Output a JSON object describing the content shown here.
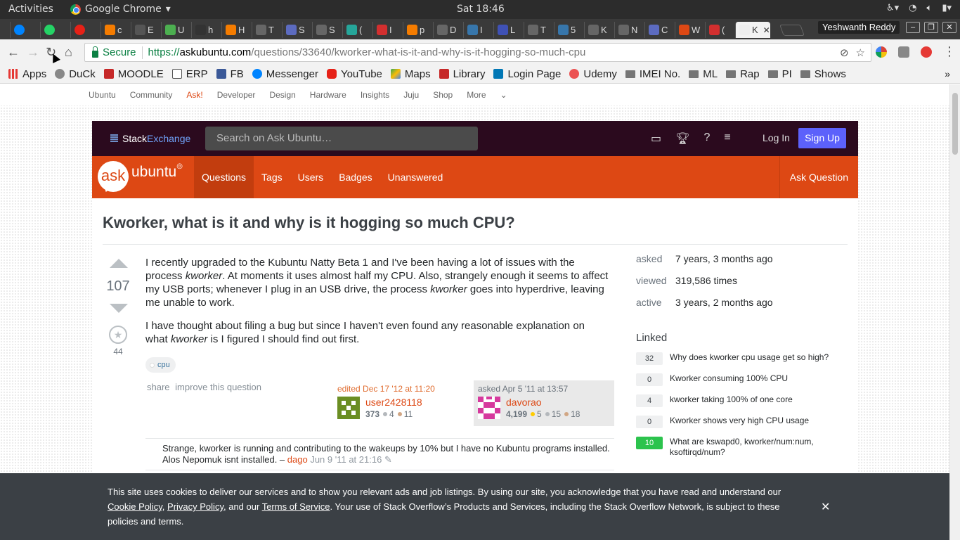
{
  "os": {
    "activities": "Activities",
    "app_name": "Google Chrome",
    "clock": "Sat 18:46"
  },
  "browser": {
    "tabs": [
      {
        "label": ""
      },
      {
        "label": ""
      },
      {
        "label": ""
      },
      {
        "label": "c"
      },
      {
        "label": "E"
      },
      {
        "label": "U"
      },
      {
        "label": "h"
      },
      {
        "label": "H"
      },
      {
        "label": "T"
      },
      {
        "label": "S"
      },
      {
        "label": "S"
      },
      {
        "label": "("
      },
      {
        "label": "I"
      },
      {
        "label": "p"
      },
      {
        "label": "D"
      },
      {
        "label": "I"
      },
      {
        "label": "L"
      },
      {
        "label": "T"
      },
      {
        "label": "5"
      },
      {
        "label": "K"
      },
      {
        "label": "N"
      },
      {
        "label": "C"
      },
      {
        "label": "W"
      },
      {
        "label": "("
      },
      {
        "label": "K"
      }
    ],
    "user": "Yeshwanth Reddy",
    "secure_label": "Secure",
    "url_scheme": "https://",
    "url_domain": "askubuntu.com",
    "url_path": "/questions/33640/kworker-what-is-it-and-why-is-it-hogging-so-much-cpu",
    "bookmarks": [
      "Apps",
      "DuCk",
      "MOODLE",
      "ERP",
      "FB",
      "Messenger",
      "YouTube",
      "Maps",
      "Library",
      "Login Page",
      "Udemy",
      "IMEI No.",
      "ML",
      "Rap",
      "PI",
      "Shows"
    ],
    "bookmark_more": "»"
  },
  "ubuntu_nav": [
    "Ubuntu",
    "Community",
    "Ask!",
    "Developer",
    "Design",
    "Hardware",
    "Insights",
    "Juju",
    "Shop",
    "More"
  ],
  "stackexchange": {
    "brand1": "Stack",
    "brand2": "Exchange",
    "search_placeholder": "Search on Ask Ubuntu…",
    "login": "Log In",
    "signup": "Sign Up"
  },
  "askubuntu": {
    "bubble": "ask",
    "word": "ubuntu",
    "nav": [
      "Questions",
      "Tags",
      "Users",
      "Badges",
      "Unanswered"
    ],
    "ask_button": "Ask Question"
  },
  "question": {
    "title": "Kworker, what is it and why is it hogging so much CPU?",
    "score": "107",
    "favorites": "44",
    "p1_a": "I recently upgraded to the Kubuntu Natty Beta 1 and I've been having a lot of issues with the process ",
    "p1_em1": "kworker",
    "p1_b": ". At moments it uses almost half my CPU. Also, strangely enough it seems to affect my USB ports; whenever I plug in an USB drive, the process ",
    "p1_em2": "kworker",
    "p1_c": " goes into hyperdrive, leaving me unable to work.",
    "p2_a": "I have thought about filing a bug but since I haven't even found any reasonable explanation on what ",
    "p2_em": "kworker",
    "p2_b": " is I figured I should find out first.",
    "tag": "cpu",
    "share": "share",
    "improve": "improve this question",
    "edited": {
      "label": "edited Dec 17 '12 at 11:20",
      "user": "user2428118",
      "rep": "373",
      "silver": "4",
      "bronze": "11"
    },
    "asked": {
      "label": "asked Apr 5 '11 at 13:57",
      "user": "davorao",
      "rep": "4,199",
      "gold": "5",
      "silver": "15",
      "bronze": "18"
    }
  },
  "comment": {
    "text": "Strange, kworker is running and contributing to the wakeups by 10% but I have no Kubuntu programs installed. Alos Nepomuk isnt installed. –",
    "user": "dago",
    "time": "Jun 9 '11 at 21:16"
  },
  "stats": [
    {
      "k": "asked",
      "v": "7 years, 3 months ago"
    },
    {
      "k": "viewed",
      "v": "319,586 times"
    },
    {
      "k": "active",
      "v": "3 years, 2 months ago"
    }
  ],
  "linked": {
    "heading": "Linked",
    "items": [
      {
        "n": "32",
        "t": "Why does kworker cpu usage get so high?"
      },
      {
        "n": "0",
        "t": "Kworker consuming 100% CPU"
      },
      {
        "n": "4",
        "t": "kworker taking 100% of one core"
      },
      {
        "n": "0",
        "t": "Kworker shows very high CPU usage"
      },
      {
        "n": "10",
        "t": "What are kswapd0, kworker/num:num, ksoftirqd/num?"
      }
    ]
  },
  "cookie": {
    "t1": "This site uses cookies to deliver our services and to show you relevant ads and job listings. By using our site, you acknowledge that you have read and understand our ",
    "l1": "Cookie Policy",
    "s1": ", ",
    "l2": "Privacy Policy",
    "s2": ", and our ",
    "l3": "Terms of Service",
    "t2": ". Your use of Stack Overflow’s Products and Services, including the Stack Overflow Network, is subject to these policies and terms.",
    "close": "✕"
  },
  "colors": {
    "accent": "#dd4814",
    "se_bar": "#2b0a1e",
    "signup": "#5c61fb",
    "accepted": "#2cc34d"
  }
}
